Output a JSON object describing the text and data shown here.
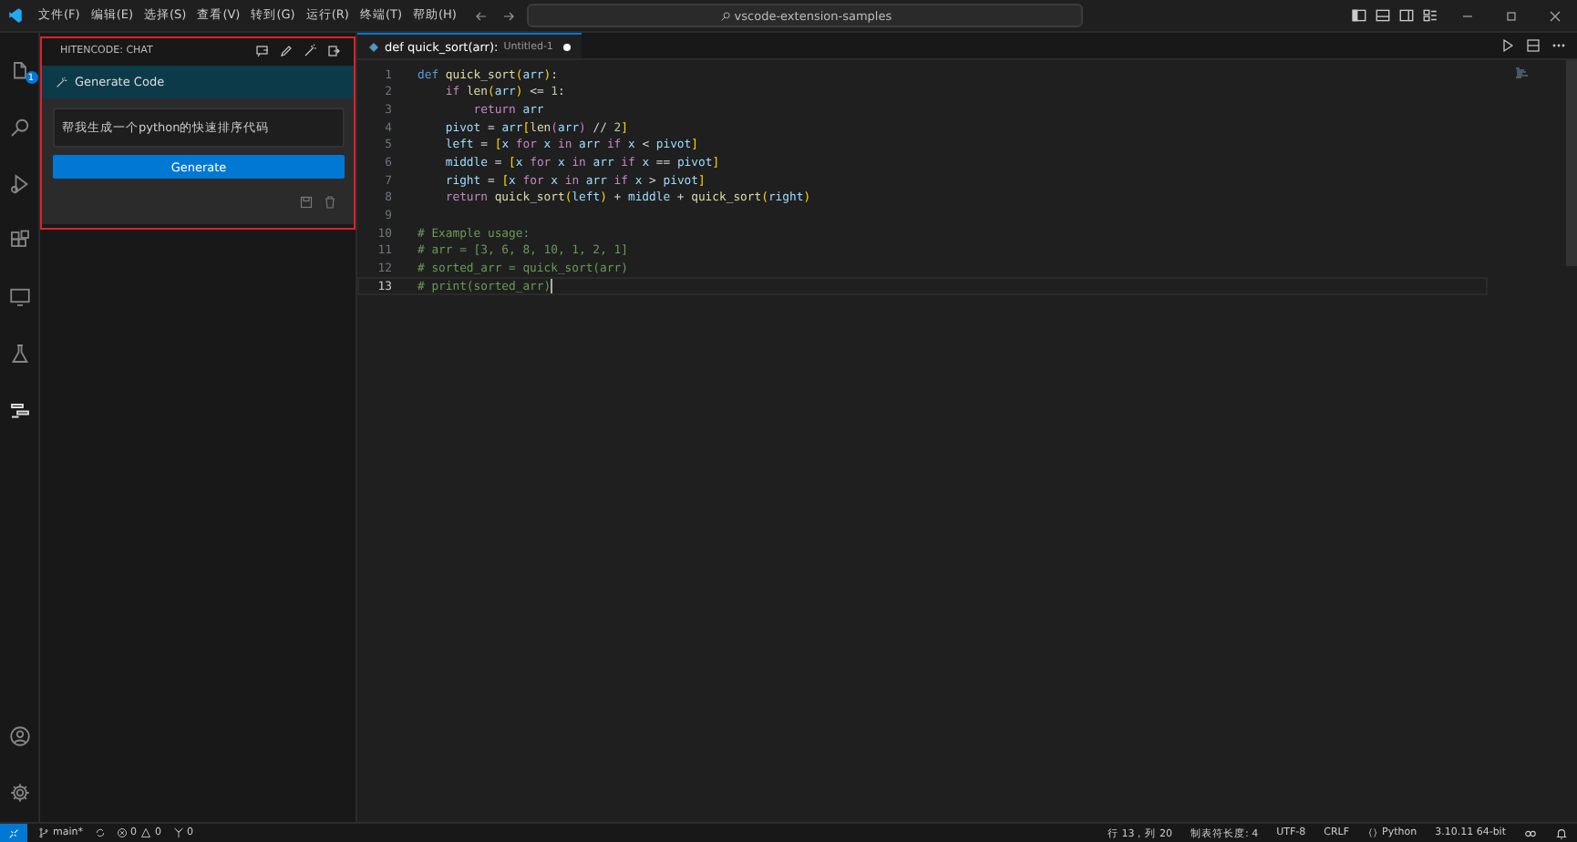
{
  "menu": [
    "文件(F)",
    "编辑(E)",
    "选择(S)",
    "查看(V)",
    "转到(G)",
    "运行(R)",
    "终端(T)",
    "帮助(H)"
  ],
  "command_center": {
    "text": "vscode-extension-samples"
  },
  "activity_bar": {
    "badge": "1"
  },
  "chat_panel": {
    "title": "HITENCODE: CHAT",
    "section": "Generate Code",
    "prompt": {
      "value": "帮我生成一个python的快速排序代码"
    },
    "button": "Generate"
  },
  "editor": {
    "tab": {
      "title": "def quick_sort(arr):",
      "description": "Untitled-1",
      "dirty": true
    },
    "lines": [
      {
        "number": "1",
        "active": false,
        "tokens": [
          {
            "kind": "storage",
            "text": "def "
          },
          {
            "kind": "function",
            "text": "quick_sort"
          },
          {
            "kind": "bracket1",
            "text": "("
          },
          {
            "kind": "variable",
            "text": "arr"
          },
          {
            "kind": "bracket1",
            "text": ")"
          },
          {
            "kind": "plain",
            "text": ":"
          }
        ]
      },
      {
        "number": "2",
        "active": false,
        "tokens": [
          {
            "kind": "control",
            "text": "    if "
          },
          {
            "kind": "function",
            "text": "len"
          },
          {
            "kind": "bracket1",
            "text": "("
          },
          {
            "kind": "variable",
            "text": "arr"
          },
          {
            "kind": "bracket1",
            "text": ")"
          },
          {
            "kind": "plain",
            "text": " <= "
          },
          {
            "kind": "number",
            "text": "1"
          },
          {
            "kind": "plain",
            "text": ":"
          }
        ]
      },
      {
        "number": "3",
        "active": false,
        "tokens": [
          {
            "kind": "control",
            "text": "        return "
          },
          {
            "kind": "variable",
            "text": "arr"
          }
        ]
      },
      {
        "number": "4",
        "active": false,
        "tokens": [
          {
            "kind": "variable",
            "text": "    pivot"
          },
          {
            "kind": "plain",
            "text": " = "
          },
          {
            "kind": "variable",
            "text": "arr"
          },
          {
            "kind": "bracket1",
            "text": "["
          },
          {
            "kind": "function",
            "text": "len"
          },
          {
            "kind": "bracket2",
            "text": "("
          },
          {
            "kind": "variable",
            "text": "arr"
          },
          {
            "kind": "bracket2",
            "text": ")"
          },
          {
            "kind": "plain",
            "text": " // "
          },
          {
            "kind": "number",
            "text": "2"
          },
          {
            "kind": "bracket1",
            "text": "]"
          }
        ]
      },
      {
        "number": "5",
        "active": false,
        "tokens": [
          {
            "kind": "variable",
            "text": "    left"
          },
          {
            "kind": "plain",
            "text": " = "
          },
          {
            "kind": "bracket1",
            "text": "["
          },
          {
            "kind": "variable",
            "text": "x"
          },
          {
            "kind": "control",
            "text": " for "
          },
          {
            "kind": "variable",
            "text": "x"
          },
          {
            "kind": "control",
            "text": " in "
          },
          {
            "kind": "variable",
            "text": "arr"
          },
          {
            "kind": "control",
            "text": " if "
          },
          {
            "kind": "variable",
            "text": "x"
          },
          {
            "kind": "plain",
            "text": " < "
          },
          {
            "kind": "variable",
            "text": "pivot"
          },
          {
            "kind": "bracket1",
            "text": "]"
          }
        ]
      },
      {
        "number": "6",
        "active": false,
        "tokens": [
          {
            "kind": "variable",
            "text": "    middle"
          },
          {
            "kind": "plain",
            "text": " = "
          },
          {
            "kind": "bracket1",
            "text": "["
          },
          {
            "kind": "variable",
            "text": "x"
          },
          {
            "kind": "control",
            "text": " for "
          },
          {
            "kind": "variable",
            "text": "x"
          },
          {
            "kind": "control",
            "text": " in "
          },
          {
            "kind": "variable",
            "text": "arr"
          },
          {
            "kind": "control",
            "text": " if "
          },
          {
            "kind": "variable",
            "text": "x"
          },
          {
            "kind": "plain",
            "text": " == "
          },
          {
            "kind": "variable",
            "text": "pivot"
          },
          {
            "kind": "bracket1",
            "text": "]"
          }
        ]
      },
      {
        "number": "7",
        "active": false,
        "tokens": [
          {
            "kind": "variable",
            "text": "    right"
          },
          {
            "kind": "plain",
            "text": " = "
          },
          {
            "kind": "bracket1",
            "text": "["
          },
          {
            "kind": "variable",
            "text": "x"
          },
          {
            "kind": "control",
            "text": " for "
          },
          {
            "kind": "variable",
            "text": "x"
          },
          {
            "kind": "control",
            "text": " in "
          },
          {
            "kind": "variable",
            "text": "arr"
          },
          {
            "kind": "control",
            "text": " if "
          },
          {
            "kind": "variable",
            "text": "x"
          },
          {
            "kind": "plain",
            "text": " > "
          },
          {
            "kind": "variable",
            "text": "pivot"
          },
          {
            "kind": "bracket1",
            "text": "]"
          }
        ]
      },
      {
        "number": "8",
        "active": false,
        "tokens": [
          {
            "kind": "control",
            "text": "    return "
          },
          {
            "kind": "function",
            "text": "quick_sort"
          },
          {
            "kind": "bracket1",
            "text": "("
          },
          {
            "kind": "variable",
            "text": "left"
          },
          {
            "kind": "bracket1",
            "text": ")"
          },
          {
            "kind": "plain",
            "text": " + "
          },
          {
            "kind": "variable",
            "text": "middle"
          },
          {
            "kind": "plain",
            "text": " + "
          },
          {
            "kind": "function",
            "text": "quick_sort"
          },
          {
            "kind": "bracket1",
            "text": "("
          },
          {
            "kind": "variable",
            "text": "right"
          },
          {
            "kind": "bracket1",
            "text": ")"
          }
        ]
      },
      {
        "number": "9",
        "active": false
      },
      {
        "number": "10",
        "active": false,
        "tokens": [
          {
            "kind": "comment",
            "text": "# Example usage:"
          }
        ]
      },
      {
        "number": "11",
        "active": false,
        "tokens": [
          {
            "kind": "comment",
            "text": "# arr = [3, 6, 8, 10, 1, 2, 1]"
          }
        ]
      },
      {
        "number": "12",
        "active": false,
        "tokens": [
          {
            "kind": "comment",
            "text": "# sorted_arr = quick_sort(arr)"
          }
        ]
      },
      {
        "number": "13",
        "active": true,
        "tokens": [
          {
            "kind": "comment",
            "text": "# print(sorted_arr)"
          }
        ]
      }
    ]
  },
  "status_bar": {
    "branch": "main*",
    "errors": "0",
    "warnings": "0",
    "ports": "0",
    "items": [
      "行 13，列 20",
      "制表符长度: 4",
      "UTF-8",
      "CRLF",
      "Python",
      "3.10.11 64-bit"
    ]
  }
}
